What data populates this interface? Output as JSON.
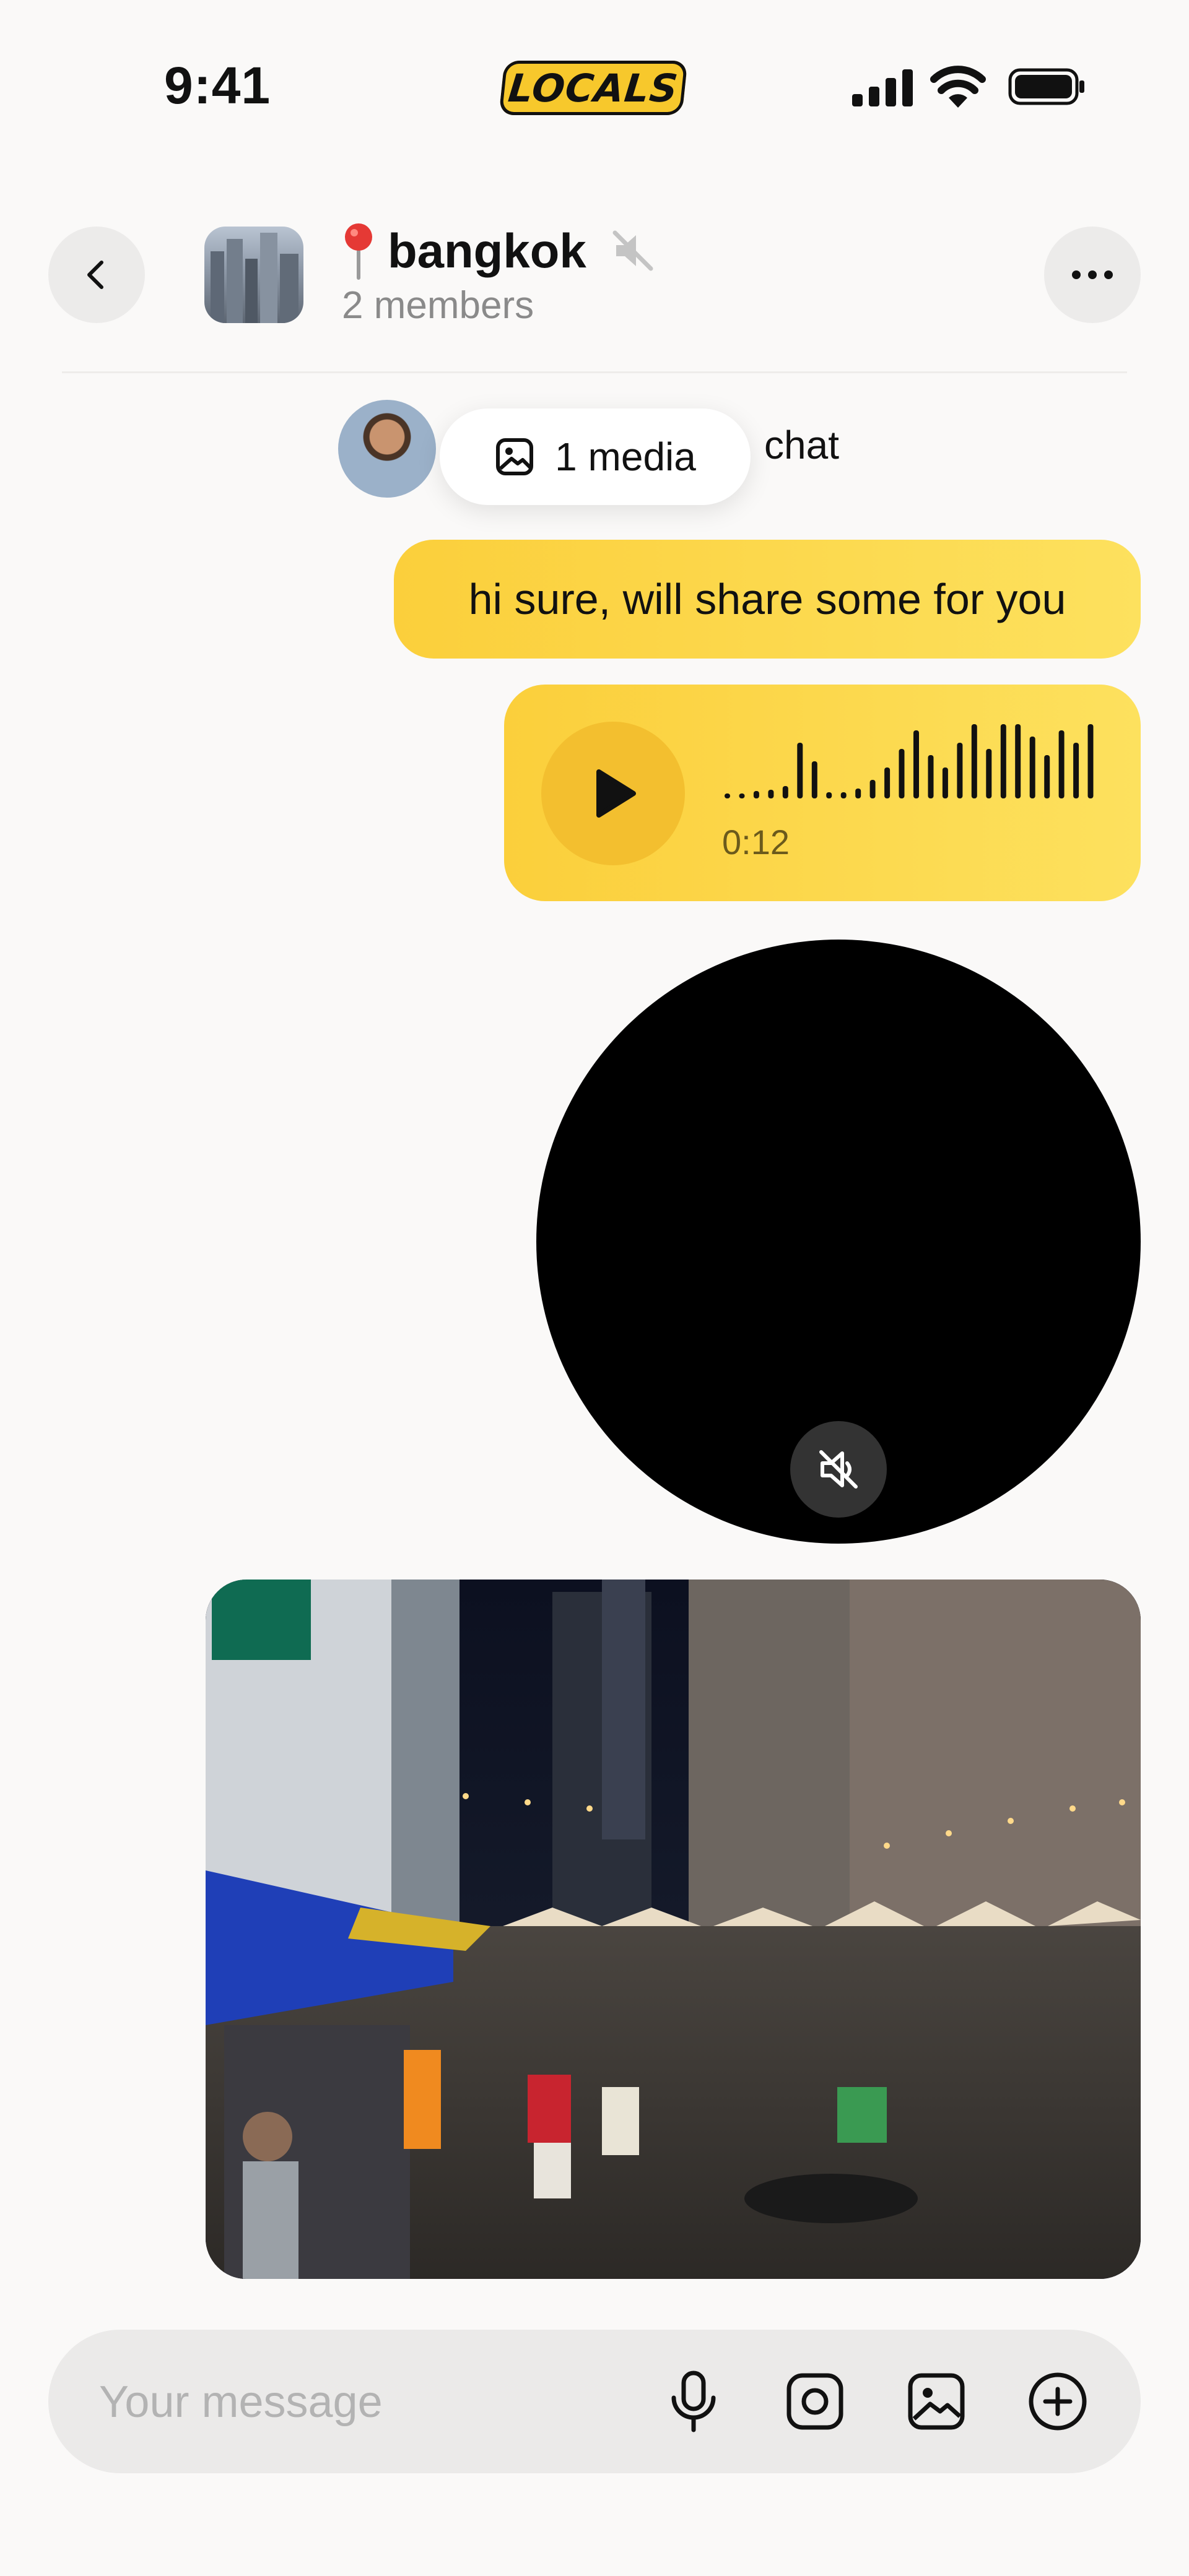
{
  "status_bar": {
    "time": "9:41",
    "logo": "LOCALS"
  },
  "header": {
    "title": "bangkok",
    "subtitle": "2 members",
    "title_icon": "location-pin-icon",
    "muted_icon": "muted-speaker-icon"
  },
  "pinned": {
    "partial_text": "chat",
    "media_pill_label": "1 media"
  },
  "messages": {
    "text_message": "hi sure, will share some for you",
    "voice_duration": "0:12"
  },
  "composer": {
    "placeholder": "Your message"
  },
  "colors": {
    "accent": "#fbcf3b",
    "background": "#faf9f8"
  }
}
